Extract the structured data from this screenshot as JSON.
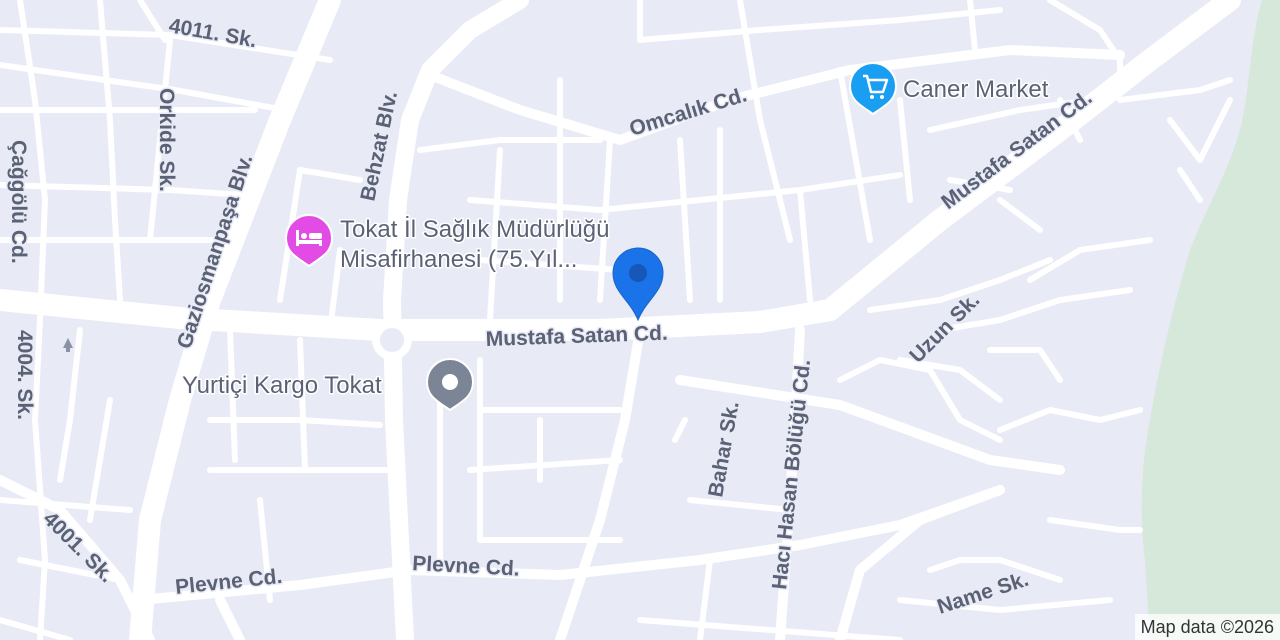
{
  "map": {
    "colors": {
      "land": "#e8eaf6",
      "road": "#ffffff",
      "park": "#d6e8d9",
      "label": "#5b6275",
      "hotel_pin": "#e24be4",
      "shop_pin": "#1a9ef2",
      "place_pin": "#7b8596",
      "marker": "#1a73e8"
    },
    "streets": {
      "s4011": "4011. Sk.",
      "orkide": "Orkide Sk.",
      "caggolu": "Çağgölü Cd.",
      "gaziosmanpasa": "Gaziosmanpaşa Blv.",
      "behzat": "Behzat Blv.",
      "omcalik": "Omcalık Cd.",
      "mustafa_satan_1": "Mustafa Satan Cd.",
      "mustafa_satan_2": "Mustafa Satan Cd.",
      "s4004": "4004. Sk.",
      "s4001": "4001. Sk.",
      "plevne_1": "Plevne Cd.",
      "plevne_2": "Plevne Cd.",
      "bahar": "Bahar Sk.",
      "haci_hasan": "Hacı Hasan Bölüğü Cd.",
      "uzun": "Uzun Sk.",
      "name": "Name Sk."
    },
    "pois": {
      "caner_market": {
        "name": "Caner Market",
        "icon": "shopping-cart-icon"
      },
      "tokat_il": {
        "line1": "Tokat İl Sağlık Müdürlüğü",
        "line2": "Misafirhanesi (75.Yıl...",
        "icon": "bed-icon"
      },
      "yurtici": {
        "name": "Yurtiçi Kargo Tokat",
        "icon": "place-dot-icon"
      }
    },
    "marker": {
      "icon": "location-pin-icon"
    },
    "attribution": "Map data ©2026"
  }
}
